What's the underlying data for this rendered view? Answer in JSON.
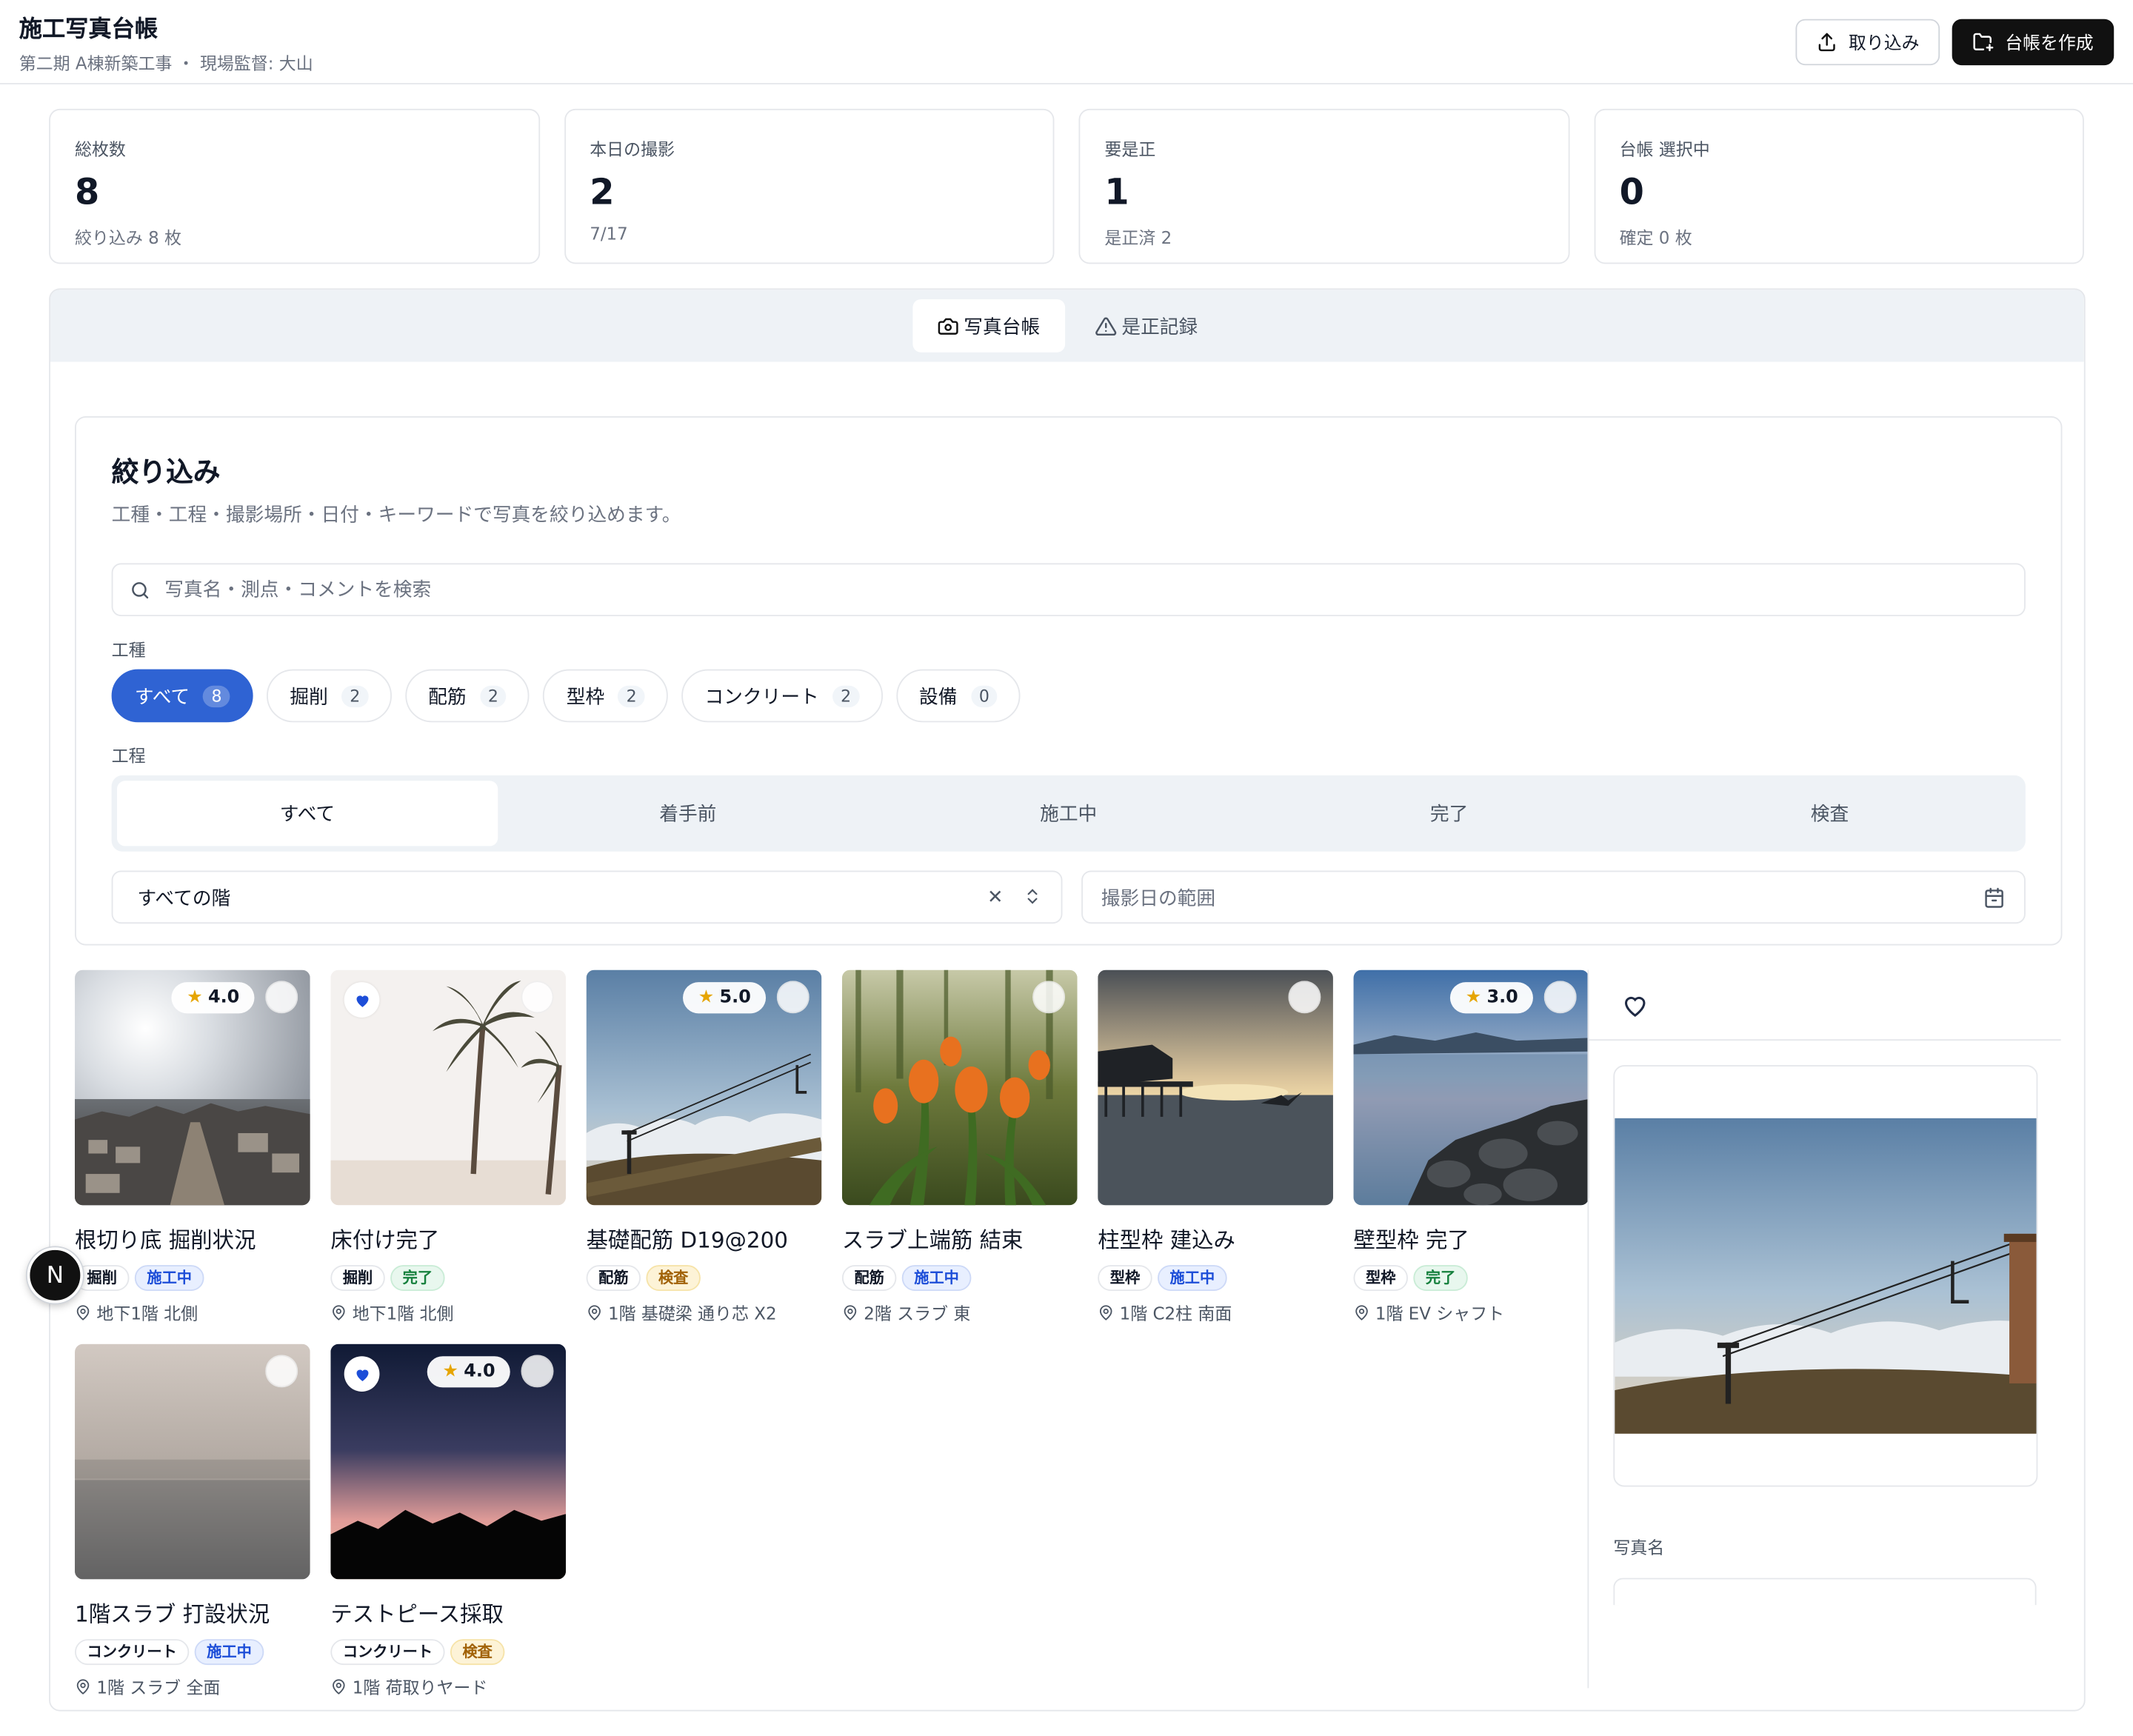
{
  "header": {
    "title": "施工写真台帳",
    "subtitle": "第二期 A棟新築工事 ・ 現場監督: 大山",
    "import_label": "取り込み",
    "create_label": "台帳を作成"
  },
  "stats": [
    {
      "label": "総枚数",
      "value": "8",
      "sub": "絞り込み 8 枚"
    },
    {
      "label": "本日の撮影",
      "value": "2",
      "sub": "7/17"
    },
    {
      "label": "要是正",
      "value": "1",
      "sub": "是正済 2"
    },
    {
      "label": "台帳 選択中",
      "value": "0",
      "sub": "確定 0 枚"
    }
  ],
  "tabs": [
    {
      "label": "写真台帳",
      "icon": "camera-icon"
    },
    {
      "label": "是正記録",
      "icon": "warning-icon"
    }
  ],
  "filter": {
    "title": "絞り込み",
    "description": "工種・工程・撮影場所・日付・キーワードで写真を絞り込めます。",
    "search_placeholder": "写真名・測点・コメントを検索",
    "trade_label": "工種",
    "trades": [
      {
        "label": "すべて",
        "count": "8"
      },
      {
        "label": "掘削",
        "count": "2"
      },
      {
        "label": "配筋",
        "count": "2"
      },
      {
        "label": "型枠",
        "count": "2"
      },
      {
        "label": "コンクリート",
        "count": "2"
      },
      {
        "label": "設備",
        "count": "0"
      }
    ],
    "stage_label": "工程",
    "stages": [
      "すべて",
      "着手前",
      "施工中",
      "完了",
      "検査"
    ],
    "floor_value": "すべての階",
    "date_placeholder": "撮影日の範囲"
  },
  "photos": [
    {
      "name": "根切り底 掘削状況",
      "trade": "掘削",
      "status": "施工中",
      "location": "地下1階 北側",
      "rating": "4.0",
      "favorite": false
    },
    {
      "name": "床付け完了",
      "trade": "掘削",
      "status": "完了",
      "location": "地下1階 北側",
      "rating": "",
      "favorite": true
    },
    {
      "name": "基礎配筋 D19@200",
      "trade": "配筋",
      "status": "検査",
      "location": "1階 基礎梁 通り芯 X2",
      "rating": "5.0",
      "favorite": false
    },
    {
      "name": "スラブ上端筋 結束",
      "trade": "配筋",
      "status": "施工中",
      "location": "2階 スラブ 東",
      "rating": "",
      "favorite": false
    },
    {
      "name": "柱型枠 建込み",
      "trade": "型枠",
      "status": "施工中",
      "location": "1階 C2柱 南面",
      "rating": "",
      "favorite": false
    },
    {
      "name": "壁型枠 完了",
      "trade": "型枠",
      "status": "完了",
      "location": "1階 EV シャフト",
      "rating": "3.0",
      "favorite": false
    },
    {
      "name": "1階スラブ 打設状況",
      "trade": "コンクリート",
      "status": "施工中",
      "location": "1階 スラブ 全面",
      "rating": "",
      "favorite": false
    },
    {
      "name": "テストピース採取",
      "trade": "コンクリート",
      "status": "検査",
      "location": "1階 荷取りヤード",
      "rating": "4.0",
      "favorite": true
    }
  ],
  "side": {
    "field_label": "写真名"
  },
  "avatar": "N"
}
